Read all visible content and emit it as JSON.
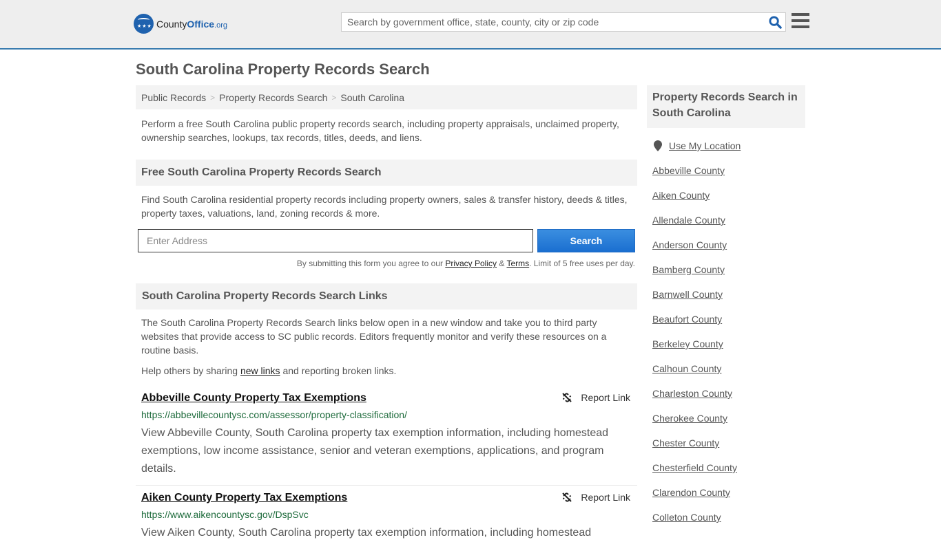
{
  "header": {
    "logo": {
      "county": "County",
      "office": "Office",
      "tld": ".org"
    },
    "search_placeholder": "Search by government office, state, county, city or zip code"
  },
  "page_title": "South Carolina Property Records Search",
  "breadcrumb": [
    "Public Records",
    "Property Records Search",
    "South Carolina"
  ],
  "intro": "Perform a free South Carolina public property records search, including property appraisals, unclaimed property, ownership searches, lookups, tax records, titles, deeds, and liens.",
  "free_search": {
    "heading": "Free South Carolina Property Records Search",
    "description": "Find South Carolina residential property records including property owners, sales & transfer history, deeds & titles, property taxes, valuations, land, zoning records & more.",
    "input_placeholder": "Enter Address",
    "button_label": "Search",
    "disclaimer_prefix": "By submitting this form you agree to our ",
    "privacy_label": "Privacy Policy",
    "amp": " & ",
    "terms_label": "Terms",
    "disclaimer_suffix": ". Limit of 5 free uses per day."
  },
  "links_section": {
    "heading": "South Carolina Property Records Search Links",
    "description": "The South Carolina Property Records Search links below open in a new window and take you to third party websites that provide access to SC public records. Editors frequently monitor and verify these resources on a routine basis.",
    "help_prefix": "Help others by sharing ",
    "help_link": "new links",
    "help_suffix": " and reporting broken links."
  },
  "results": [
    {
      "title": "Abbeville County Property Tax Exemptions",
      "url": "https://abbevillecountysc.com/assessor/property-classification/",
      "description": "View Abbeville County, South Carolina property tax exemption information, including homestead exemptions, low income assistance, senior and veteran exemptions, applications, and program details.",
      "report_label": "Report Link"
    },
    {
      "title": "Aiken County Property Tax Exemptions",
      "url": "https://www.aikencountysc.gov/DspSvc",
      "description": "View Aiken County, South Carolina property tax exemption information, including homestead",
      "report_label": "Report Link"
    }
  ],
  "sidebar": {
    "heading": "Property Records Search in South Carolina",
    "use_location": "Use My Location",
    "counties": [
      "Abbeville County",
      "Aiken County",
      "Allendale County",
      "Anderson County",
      "Bamberg County",
      "Barnwell County",
      "Beaufort County",
      "Berkeley County",
      "Calhoun County",
      "Charleston County",
      "Cherokee County",
      "Chester County",
      "Chesterfield County",
      "Clarendon County",
      "Colleton County"
    ]
  }
}
